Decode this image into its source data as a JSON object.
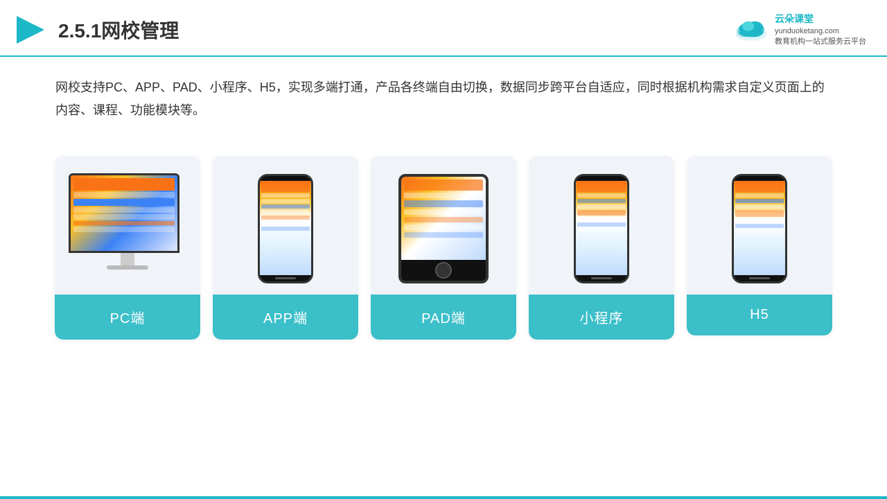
{
  "header": {
    "title": "2.5.1网校管理",
    "logo_name": "云朵课堂",
    "logo_domain": "yunduoketang.com",
    "logo_tagline": "教育机构一站\n式服务云平台"
  },
  "description": {
    "text": "网校支持PC、APP、PAD、小程序、H5，实现多端打通，产品各终端自由切换，数据同步跨平台自适应，同时根据机构需求自定义页面上的内容、课程、功能模块等。"
  },
  "cards": [
    {
      "id": "pc",
      "label": "PC端"
    },
    {
      "id": "app",
      "label": "APP端"
    },
    {
      "id": "pad",
      "label": "PAD端"
    },
    {
      "id": "mini",
      "label": "小程序"
    },
    {
      "id": "h5",
      "label": "H5"
    }
  ],
  "accent_color": "#3bbfc9",
  "divider_color": "#1db8c7"
}
